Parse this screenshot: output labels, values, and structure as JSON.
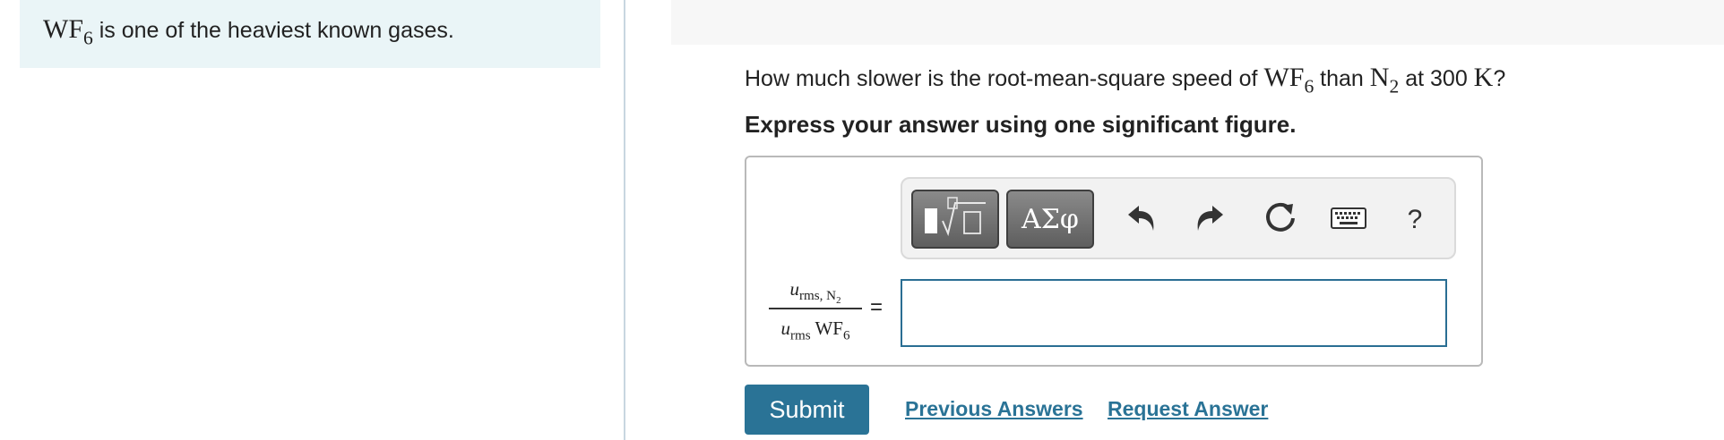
{
  "intro": {
    "formula": "WF",
    "formula_sub": "6",
    "text": " is one of the heaviest known gases."
  },
  "question": {
    "t1": "How much slower is the root-mean-square speed of ",
    "m1": "WF",
    "m1_sub": "6",
    "t2": " than ",
    "m2": "N",
    "m2_sub": "2",
    "t3": " at 300 ",
    "m3": "K",
    "t4": "?"
  },
  "instruction": "Express your answer using one significant figure.",
  "toolbar": {
    "symbols_label": "ΑΣφ",
    "help_label": "?",
    "icons": [
      "templates-icon",
      "undo-icon",
      "redo-icon",
      "reset-icon",
      "keyboard-icon",
      "help-icon"
    ]
  },
  "fraction": {
    "num_var": "u",
    "num_sub": "rms, N",
    "num_sub2": "2",
    "den_var": "u",
    "den_sub": "rms",
    "den_formula": " WF",
    "den_formula_sub": "6"
  },
  "equals": "=",
  "answer": {
    "value": ""
  },
  "actions": {
    "submit_label": "Submit",
    "previous_label": "Previous Answers",
    "request_label": "Request Answer"
  },
  "colors": {
    "accent": "#2a7396",
    "intro_bg": "#eaf5f7",
    "input_border": "#2a6e93"
  }
}
